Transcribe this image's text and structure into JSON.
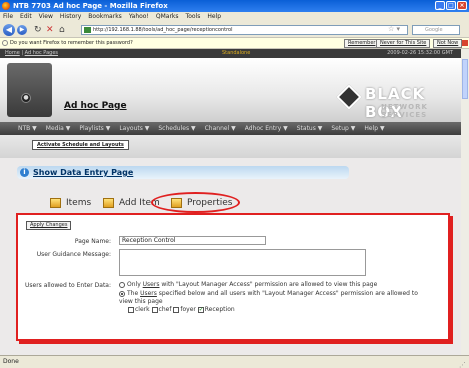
{
  "window": {
    "title": "NTB 7703 Ad hoc Page - Mozilla Firefox"
  },
  "menubar": {
    "items": [
      "File",
      "Edit",
      "View",
      "History",
      "Bookmarks",
      "Yahoo!",
      "QMarks",
      "Tools",
      "Help"
    ]
  },
  "nav": {
    "url": "http://192.168.1.88/tools/ad_hoc_page/receptioncontrol",
    "search_placeholder": "Google"
  },
  "password_bar": {
    "message": "Do you want Firefox to remember this password?",
    "remember": "Remember",
    "never": "Never for This Site",
    "not_now": "Not Now"
  },
  "breadcrumb": {
    "home": "Home",
    "sep": " | ",
    "page": "Ad hoc Pages",
    "mode": "Standalone",
    "datetime": "2009-02-26 15:32:00 GMT"
  },
  "header": {
    "title": "Ad hoc Page",
    "logo_main": "BLACK BOX",
    "logo_sub": "NETWORK SERVICES"
  },
  "menu": {
    "items": [
      "NTB ▼",
      "Media ▼",
      "Playlists ▼",
      "Layouts ▼",
      "Schedules ▼",
      "Channel ▼",
      "Adhoc Entry ▼",
      "Status ▼",
      "Setup ▼",
      "Help ▼"
    ]
  },
  "activate_button": "Activate Schedule and Layouts",
  "show_data_entry": "Show Data Entry Page",
  "tabs": {
    "items": "Items",
    "add_item": "Add Item",
    "properties": "Properties"
  },
  "form": {
    "apply": "Apply Changes",
    "page_name_label": "Page Name:",
    "page_name_value": "Reception Control",
    "guidance_label": "User Guidance Message:",
    "guidance_value": "",
    "users_label": "Users allowed to Enter Data:",
    "option1_pre": "Only ",
    "option1_link": "Users",
    "option1_post": " with \"Layout Manager Access\" permission are allowed to view this page",
    "option2_pre": "The ",
    "option2_link": "Users",
    "option2_post": " specified below and all users with \"Layout Manager Access\" permission are allowed to",
    "option2_cont": "view this page",
    "users": [
      "clerk",
      "chef",
      "foyer",
      "Reception"
    ],
    "users_checked": [
      false,
      false,
      false,
      true
    ]
  },
  "status": {
    "text": "Done"
  }
}
